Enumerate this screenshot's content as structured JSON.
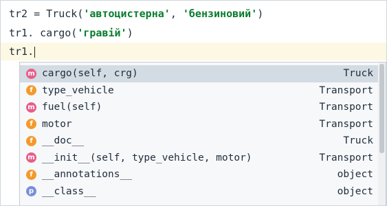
{
  "editor": {
    "lines": [
      {
        "prefix": "tr2 = Truck(",
        "str1": "'автоцистерна'",
        "sep": ", ",
        "str2": "'бензиновий'",
        "suffix": ")"
      },
      {
        "prefix": "tr1. cargo(",
        "str1": "'гравій'",
        "suffix": ")"
      },
      {
        "text": "tr1."
      }
    ]
  },
  "autocomplete": {
    "items": [
      {
        "kind": "m",
        "icon": "method-icon",
        "name": "cargo(self, crg)",
        "type": "Truck",
        "selected": true
      },
      {
        "kind": "f",
        "icon": "field-icon",
        "name": "type_vehicle",
        "type": "Transport"
      },
      {
        "kind": "m",
        "icon": "method-icon",
        "name": "fuel(self)",
        "type": "Transport"
      },
      {
        "kind": "f",
        "icon": "field-icon",
        "name": "motor",
        "type": "Transport"
      },
      {
        "kind": "f",
        "icon": "field-icon",
        "name": "__doc__",
        "type": "Truck"
      },
      {
        "kind": "m",
        "icon": "method-icon",
        "name": "__init__(self, type_vehicle, motor)",
        "type": "Transport"
      },
      {
        "kind": "f",
        "icon": "field-icon",
        "name": "__annotations__",
        "type": "object"
      },
      {
        "kind": "p",
        "icon": "property-icon",
        "name": "__class__",
        "type": "object"
      }
    ]
  },
  "colors": {
    "string": "#0a7c2f",
    "method_badge": "#e85d8a",
    "field_badge": "#f39a2b",
    "property_badge": "#7a8fd8",
    "selected_row": "#d3dbe3",
    "current_line": "#fdf8e3"
  }
}
